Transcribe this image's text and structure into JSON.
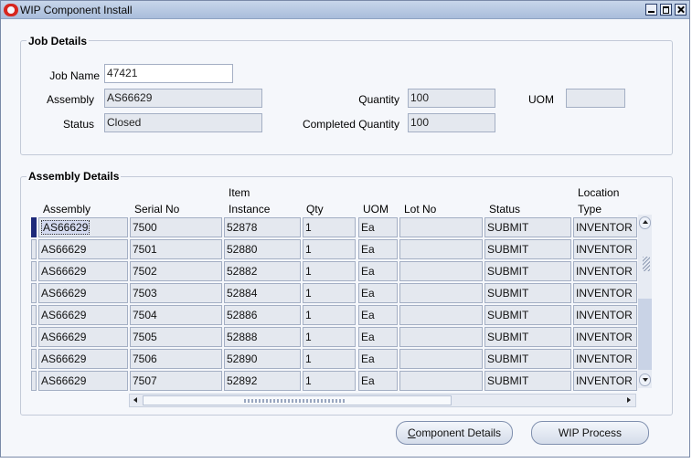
{
  "window": {
    "title": "WIP Component Install"
  },
  "job_details": {
    "group_title": "Job Details",
    "job_name_label": "Job Name",
    "job_name": "47421",
    "assembly_label": "Assembly",
    "assembly": "AS66629",
    "status_label": "Status",
    "status": "Closed",
    "quantity_label": "Quantity",
    "quantity": "100",
    "completed_quantity_label": "Completed Quantity",
    "completed_quantity": "100",
    "uom_label": "UOM",
    "uom": ""
  },
  "assembly_details": {
    "group_title": "Assembly Details",
    "columns": {
      "assembly": "Assembly",
      "serial_no": "Serial No",
      "item_instance_1": "Item",
      "item_instance_2": "Instance",
      "qty": "Qty",
      "uom": "UOM",
      "lot_no": "Lot No",
      "status": "Status",
      "location_type_1": "Location",
      "location_type_2": "Type"
    },
    "rows": [
      {
        "assembly": "AS66629",
        "serial_no": "7500",
        "item_instance": "52878",
        "qty": "1",
        "uom": "Ea",
        "lot_no": "",
        "status": "SUBMIT",
        "location_type": "INVENTOR"
      },
      {
        "assembly": "AS66629",
        "serial_no": "7501",
        "item_instance": "52880",
        "qty": "1",
        "uom": "Ea",
        "lot_no": "",
        "status": "SUBMIT",
        "location_type": "INVENTOR"
      },
      {
        "assembly": "AS66629",
        "serial_no": "7502",
        "item_instance": "52882",
        "qty": "1",
        "uom": "Ea",
        "lot_no": "",
        "status": "SUBMIT",
        "location_type": "INVENTOR"
      },
      {
        "assembly": "AS66629",
        "serial_no": "7503",
        "item_instance": "52884",
        "qty": "1",
        "uom": "Ea",
        "lot_no": "",
        "status": "SUBMIT",
        "location_type": "INVENTOR"
      },
      {
        "assembly": "AS66629",
        "serial_no": "7504",
        "item_instance": "52886",
        "qty": "1",
        "uom": "Ea",
        "lot_no": "",
        "status": "SUBMIT",
        "location_type": "INVENTOR"
      },
      {
        "assembly": "AS66629",
        "serial_no": "7505",
        "item_instance": "52888",
        "qty": "1",
        "uom": "Ea",
        "lot_no": "",
        "status": "SUBMIT",
        "location_type": "INVENTOR"
      },
      {
        "assembly": "AS66629",
        "serial_no": "7506",
        "item_instance": "52890",
        "qty": "1",
        "uom": "Ea",
        "lot_no": "",
        "status": "SUBMIT",
        "location_type": "INVENTOR"
      },
      {
        "assembly": "AS66629",
        "serial_no": "7507",
        "item_instance": "52892",
        "qty": "1",
        "uom": "Ea",
        "lot_no": "",
        "status": "SUBMIT",
        "location_type": "INVENTOR"
      }
    ]
  },
  "buttons": {
    "component_details_mnemonic": "C",
    "component_details_rest": "omponent Details",
    "wip_process": "WIP Process"
  },
  "icons": {
    "app": "oracle-icon",
    "minimize": "minimize-icon",
    "maximize": "maximize-icon",
    "close": "close-icon"
  },
  "colors": {
    "title_bar": "#a9bddb",
    "current_row_indicator": "#1e2a7a"
  }
}
